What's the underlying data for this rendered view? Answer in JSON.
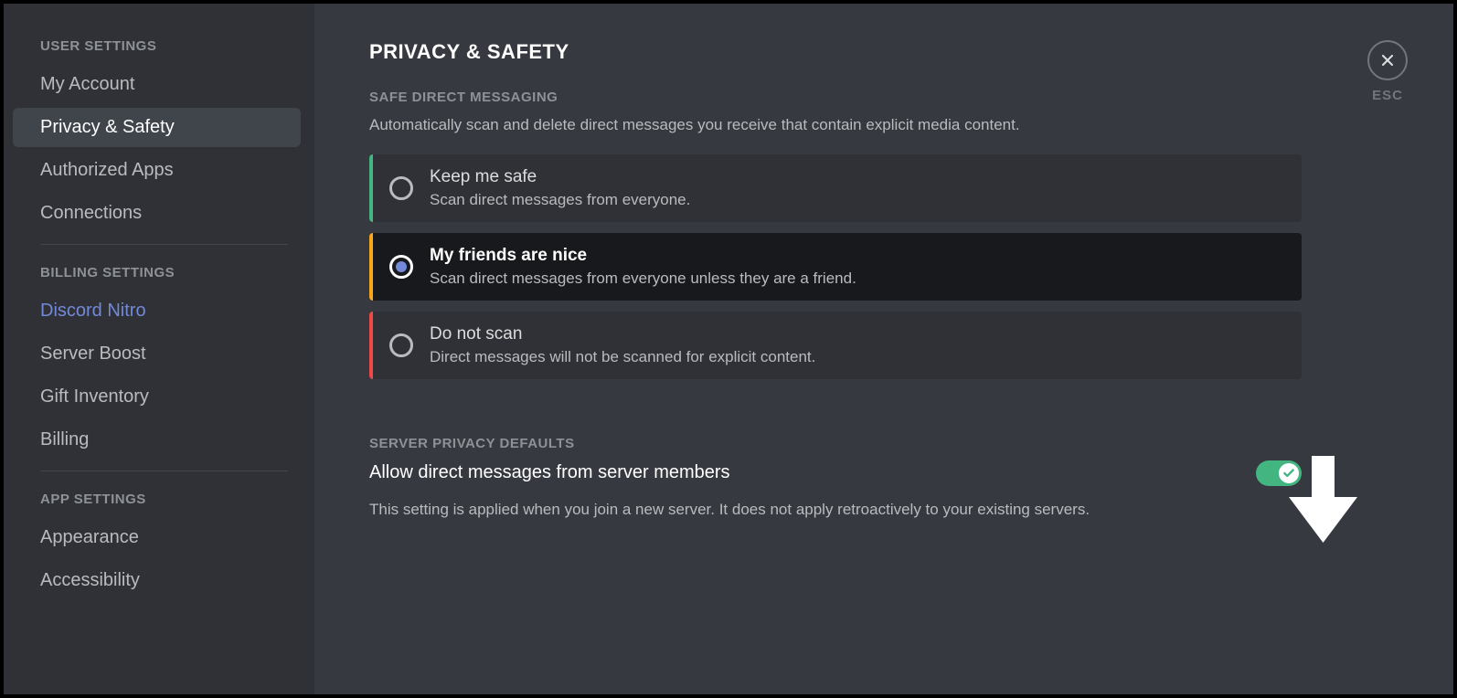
{
  "sidebar": {
    "sections": [
      {
        "header": "User Settings",
        "items": [
          {
            "label": "My Account",
            "active": false
          },
          {
            "label": "Privacy & Safety",
            "active": true
          },
          {
            "label": "Authorized Apps",
            "active": false
          },
          {
            "label": "Connections",
            "active": false
          }
        ]
      },
      {
        "header": "Billing Settings",
        "items": [
          {
            "label": "Discord Nitro",
            "active": false,
            "nitro": true
          },
          {
            "label": "Server Boost",
            "active": false
          },
          {
            "label": "Gift Inventory",
            "active": false
          },
          {
            "label": "Billing",
            "active": false
          }
        ]
      },
      {
        "header": "App Settings",
        "items": [
          {
            "label": "Appearance",
            "active": false
          },
          {
            "label": "Accessibility",
            "active": false
          }
        ]
      }
    ]
  },
  "close": {
    "label": "ESC"
  },
  "page": {
    "title": "Privacy & Safety"
  },
  "safe_dm": {
    "title": "Safe Direct Messaging",
    "description": "Automatically scan and delete direct messages you receive that contain explicit media content.",
    "options": [
      {
        "title": "Keep me safe",
        "description": "Scan direct messages from everyone.",
        "color": "green",
        "selected": false
      },
      {
        "title": "My friends are nice",
        "description": "Scan direct messages from everyone unless they are a friend.",
        "color": "yellow",
        "selected": true
      },
      {
        "title": "Do not scan",
        "description": "Direct messages will not be scanned for explicit content.",
        "color": "red",
        "selected": false
      }
    ]
  },
  "server_privacy": {
    "title": "Server Privacy Defaults",
    "toggle_label": "Allow direct messages from server members",
    "toggle_on": true,
    "description": "This setting is applied when you join a new server. It does not apply retroactively to your existing servers."
  }
}
